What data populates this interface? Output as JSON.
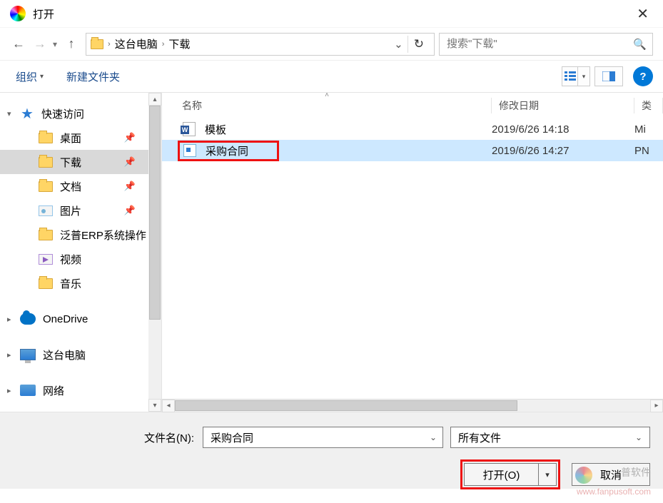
{
  "window": {
    "title": "打开"
  },
  "nav": {
    "back_enabled": true,
    "forward_enabled": false
  },
  "breadcrumb": {
    "items": [
      "这台电脑",
      "下载"
    ]
  },
  "search": {
    "placeholder": "搜索\"下载\""
  },
  "toolbar": {
    "organize": "组织",
    "new_folder": "新建文件夹"
  },
  "sidebar": {
    "quick_access": {
      "label": "快速访问",
      "items": [
        {
          "id": "desktop",
          "label": "桌面",
          "icon": "folder",
          "pinned": true
        },
        {
          "id": "downloads",
          "label": "下载",
          "icon": "folder",
          "pinned": true,
          "selected": true
        },
        {
          "id": "documents",
          "label": "文档",
          "icon": "folder",
          "pinned": true
        },
        {
          "id": "pictures",
          "label": "图片",
          "icon": "pic",
          "pinned": true
        },
        {
          "id": "fanpu",
          "label": "泛普ERP系统操作",
          "icon": "folder",
          "pinned": false
        },
        {
          "id": "videos",
          "label": "视频",
          "icon": "vid",
          "pinned": false
        },
        {
          "id": "music",
          "label": "音乐",
          "icon": "folder",
          "pinned": false
        }
      ]
    },
    "onedrive": {
      "label": "OneDrive"
    },
    "this_pc": {
      "label": "这台电脑"
    },
    "network": {
      "label": "网络"
    }
  },
  "columns": {
    "name": "名称",
    "modified": "修改日期",
    "type": "类"
  },
  "files": [
    {
      "name": "模板",
      "date": "2019/6/26 14:18",
      "type": "Mi",
      "kind": "word",
      "selected": false,
      "highlighted": false
    },
    {
      "name": "采购合同",
      "date": "2019/6/26 14:27",
      "type": "PN",
      "kind": "image",
      "selected": true,
      "highlighted": true
    }
  ],
  "footer": {
    "filename_label": "文件名(N):",
    "filename_value": "采购合同",
    "filter_label": "所有文件",
    "open_btn": "打开(O)",
    "cancel_btn": "取消"
  },
  "watermark": {
    "brand": "普软件",
    "url": "www.fanpusoft.com"
  }
}
